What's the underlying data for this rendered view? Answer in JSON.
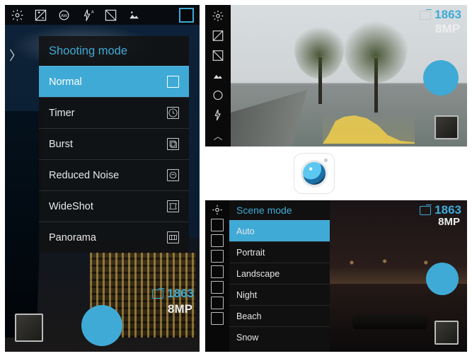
{
  "accent": "#3faad6",
  "panel1": {
    "counter": "1863",
    "resolution": "8MP",
    "menu_title": "Shooting mode",
    "modes": [
      {
        "label": "Normal",
        "icon": "square",
        "selected": true
      },
      {
        "label": "Timer",
        "icon": "clock",
        "selected": false
      },
      {
        "label": "Burst",
        "icon": "stack",
        "selected": false
      },
      {
        "label": "Reduced Noise",
        "icon": "rn",
        "selected": false
      },
      {
        "label": "WideShot",
        "icon": "wide",
        "selected": false
      },
      {
        "label": "Panorama",
        "icon": "pano",
        "selected": false
      }
    ],
    "topbar": [
      "settings-gear",
      "exposure",
      "awb",
      "flash-auto",
      "histogram",
      "gallery",
      "mode-box"
    ]
  },
  "panel2": {
    "counter": "1863",
    "resolution": "8MP",
    "sidebar": [
      "settings-gear",
      "exposure",
      "histogram",
      "gallery",
      "awb",
      "flash-auto"
    ]
  },
  "panel3": {
    "counter": "1863",
    "resolution": "8MP",
    "menu_title": "Scene mode",
    "scenes": [
      {
        "label": "Auto",
        "selected": true
      },
      {
        "label": "Portrait",
        "selected": false
      },
      {
        "label": "Landscape",
        "selected": false
      },
      {
        "label": "Night",
        "selected": false
      },
      {
        "label": "Beach",
        "selected": false
      },
      {
        "label": "Snow",
        "selected": false
      }
    ]
  }
}
